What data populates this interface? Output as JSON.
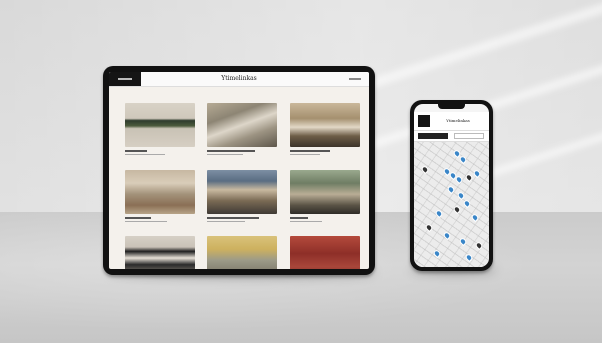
{
  "tablet": {
    "app_title": "Ytimelinkas"
  },
  "phone": {
    "app_title": "Ytimelinkas"
  }
}
